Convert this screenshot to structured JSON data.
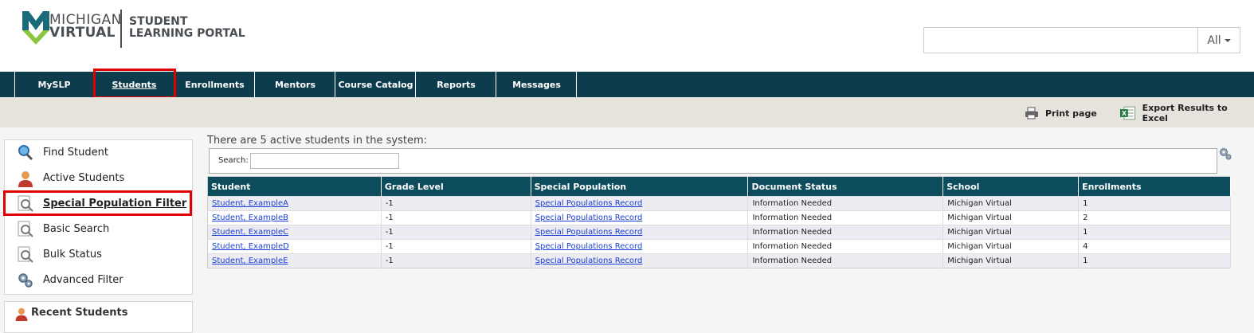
{
  "brand": {
    "line1": "MICHIGAN",
    "line2": "VIRTUAL",
    "portal_line1": "STUDENT",
    "portal_line2": "LEARNING PORTAL",
    "colors": {
      "teal": "#1a6a7a",
      "green": "#8cc63f",
      "gray": "#4a4f54"
    }
  },
  "search": {
    "value": "",
    "placeholder": "",
    "scope": "All"
  },
  "nav": {
    "items": [
      {
        "label": "MySLP"
      },
      {
        "label": "Students",
        "active": true
      },
      {
        "label": "Enrollments"
      },
      {
        "label": "Mentors"
      },
      {
        "label": "Course Catalog"
      },
      {
        "label": "Reports"
      },
      {
        "label": "Messages"
      }
    ],
    "background": "#0d3c4c"
  },
  "toolbar": {
    "print_label": "Print page",
    "print_icon": "printer-icon",
    "export_label": "Export Results to Excel",
    "export_icon": "excel-icon"
  },
  "sidebar": {
    "items": [
      {
        "label": "Find Student",
        "icon": "magnifier-icon"
      },
      {
        "label": "Active Students",
        "icon": "user-icon"
      },
      {
        "label": "Special Population Filter",
        "icon": "search-document-icon",
        "selected": true
      },
      {
        "label": "Basic Search",
        "icon": "search-document-icon"
      },
      {
        "label": "Bulk Status",
        "icon": "search-document-icon"
      },
      {
        "label": "Advanced Filter",
        "icon": "gears-icon"
      }
    ],
    "recent_label": "Recent Students"
  },
  "main": {
    "summary": "There are 5 active students in the system:",
    "search_label": "Search:",
    "search_value": "",
    "columns": [
      "Student",
      "Grade Level",
      "Special Population",
      "Document Status",
      "School",
      "Enrollments"
    ],
    "rows": [
      [
        "Student, ExampleA",
        "-1",
        "Special Populations Record",
        "Information Needed",
        "Michigan Virtual",
        "1"
      ],
      [
        "Student, ExampleB",
        "-1",
        "Special Populations Record",
        "Information Needed",
        "Michigan Virtual",
        "2"
      ],
      [
        "Student, ExampleC",
        "-1",
        "Special Populations Record",
        "Information Needed",
        "Michigan Virtual",
        "1"
      ],
      [
        "Student, ExampleD",
        "-1",
        "Special Populations Record",
        "Information Needed",
        "Michigan Virtual",
        "4"
      ],
      [
        "Student, ExampleE",
        "-1",
        "Special Populations Record",
        "Information Needed",
        "Michigan Virtual",
        "1"
      ]
    ]
  }
}
